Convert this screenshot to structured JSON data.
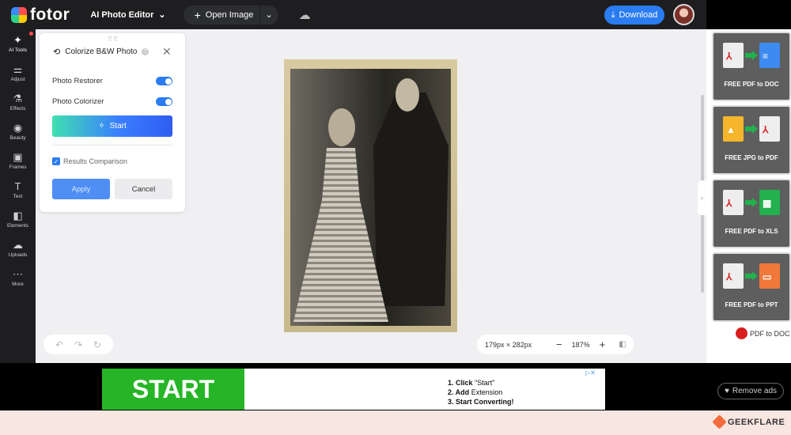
{
  "app": {
    "name": "fotor"
  },
  "menu": {
    "ai_editor": "AI Photo Editor"
  },
  "toolbar": {
    "open_image": "Open Image",
    "download": "Download"
  },
  "sidebar": {
    "items": [
      {
        "label": "AI Tools",
        "icon": "magic-wand-icon"
      },
      {
        "label": "Adjust",
        "icon": "sliders-icon"
      },
      {
        "label": "Effects",
        "icon": "flask-icon"
      },
      {
        "label": "Beauty",
        "icon": "eye-icon"
      },
      {
        "label": "Frames",
        "icon": "frame-icon"
      },
      {
        "label": "Text",
        "icon": "text-icon"
      },
      {
        "label": "Elements",
        "icon": "shapes-icon"
      },
      {
        "label": "Uploads",
        "icon": "cloud-upload-icon"
      },
      {
        "label": "More",
        "icon": "more-icon"
      }
    ]
  },
  "panel": {
    "title": "Colorize B&W Photo",
    "options": [
      {
        "label": "Photo Restorer",
        "enabled": true
      },
      {
        "label": "Photo Colorizer",
        "enabled": true
      }
    ],
    "start": "Start",
    "results_comparison": "Results Comparison",
    "results_comparison_checked": true,
    "apply": "Apply",
    "cancel": "Cancel"
  },
  "canvas": {
    "dimensions": "179px × 282px",
    "zoom": "187%"
  },
  "right_ads": [
    {
      "text": "FREE PDF to DOC"
    },
    {
      "text": "FREE JPG to PDF"
    },
    {
      "text": "FREE PDF to XLS"
    },
    {
      "text": "FREE PDF to PPT"
    }
  ],
  "right_ad_footer": "PDF to DOC",
  "banner": {
    "start": "START",
    "step1_bold": "1. Click",
    "step1_rest": "\"Start\"",
    "step2_bold": "2. Add",
    "step2_rest": "Extension",
    "step3": "3. Start Converting!"
  },
  "remove_ads": "Remove ads",
  "watermark": "GEEKFLARE",
  "colors": {
    "accent": "#2a7cf0",
    "topbar": "#1e1e21",
    "canvas_bg": "#f0f0f2",
    "banner_green": "#26b526"
  }
}
